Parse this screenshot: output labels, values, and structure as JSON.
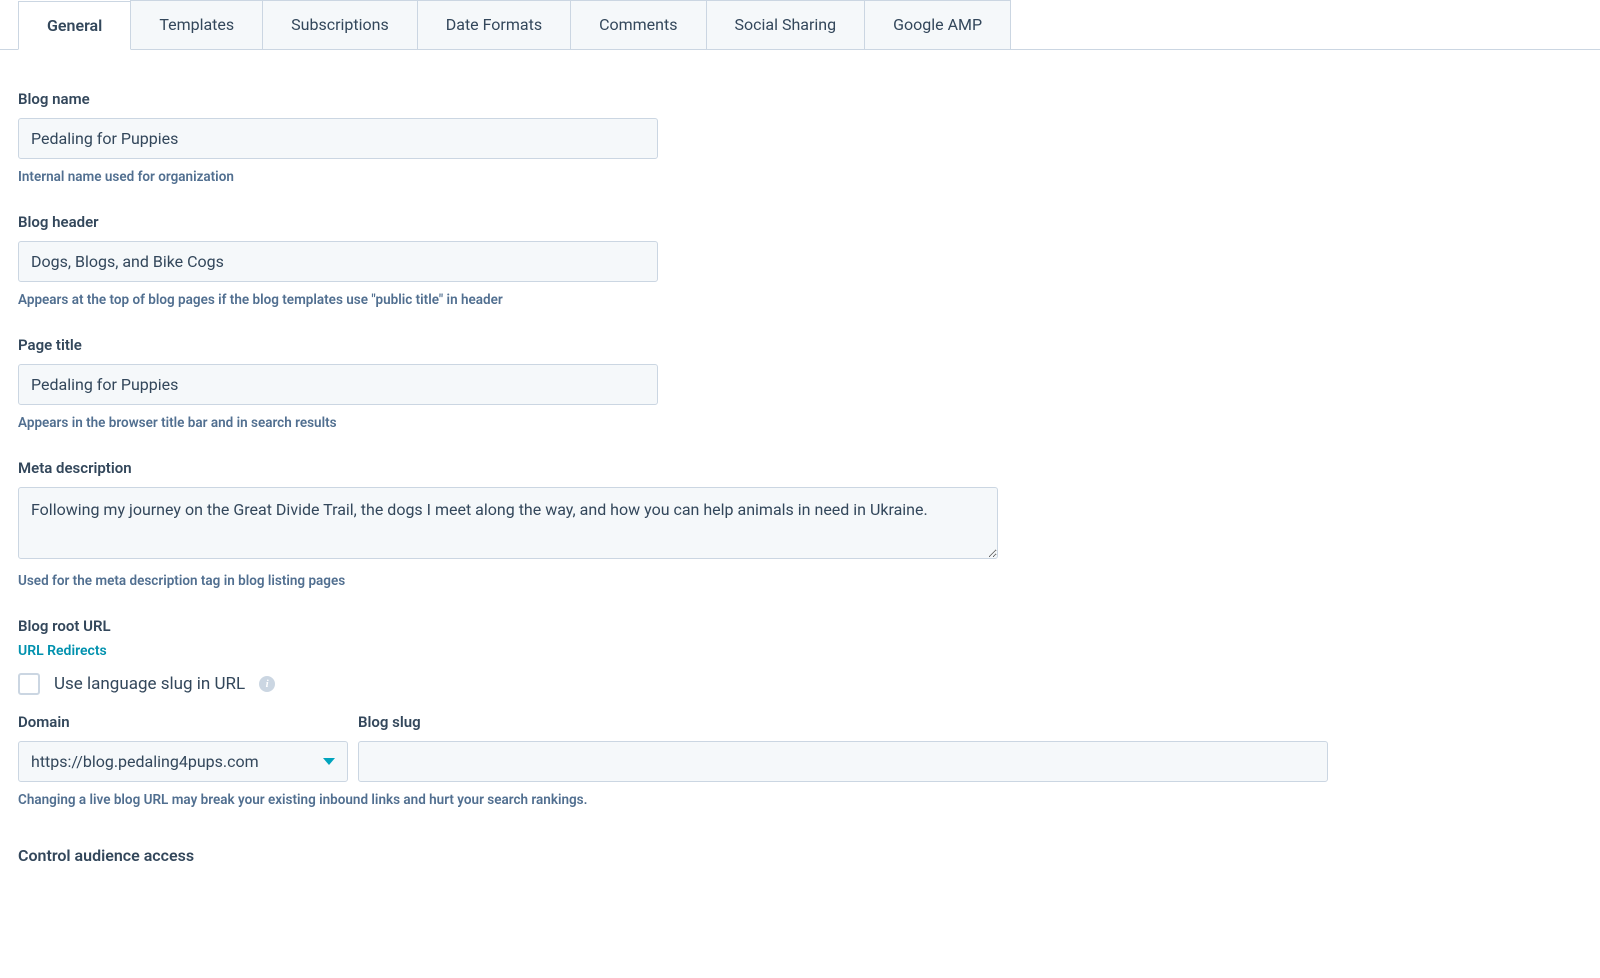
{
  "tabs": {
    "general": "General",
    "templates": "Templates",
    "subscriptions": "Subscriptions",
    "date_formats": "Date Formats",
    "comments": "Comments",
    "social_sharing": "Social Sharing",
    "google_amp": "Google AMP"
  },
  "fields": {
    "blog_name": {
      "label": "Blog name",
      "value": "Pedaling for Puppies",
      "help": "Internal name used for organization"
    },
    "blog_header": {
      "label": "Blog header",
      "value": "Dogs, Blogs, and Bike Cogs",
      "help": "Appears at the top of blog pages if the blog templates use \"public title\" in header"
    },
    "page_title": {
      "label": "Page title",
      "value": "Pedaling for Puppies",
      "help": "Appears in the browser title bar and in search results"
    },
    "meta_description": {
      "label": "Meta description",
      "value": "Following my journey on the Great Divide Trail, the dogs I meet along the way, and how you can help animals in need in Ukraine.",
      "help": "Used for the meta description tag in blog listing pages"
    },
    "blog_root_url": {
      "label": "Blog root URL",
      "redirects_link": "URL Redirects",
      "language_slug_label": "Use language slug in URL",
      "domain_label": "Domain",
      "domain_value": "https://blog.pedaling4pups.com",
      "slug_label": "Blog slug",
      "slug_value": "",
      "help": "Changing a live blog URL may break your existing inbound links and hurt your search rankings."
    },
    "audience_access": {
      "label": "Control audience access"
    }
  }
}
